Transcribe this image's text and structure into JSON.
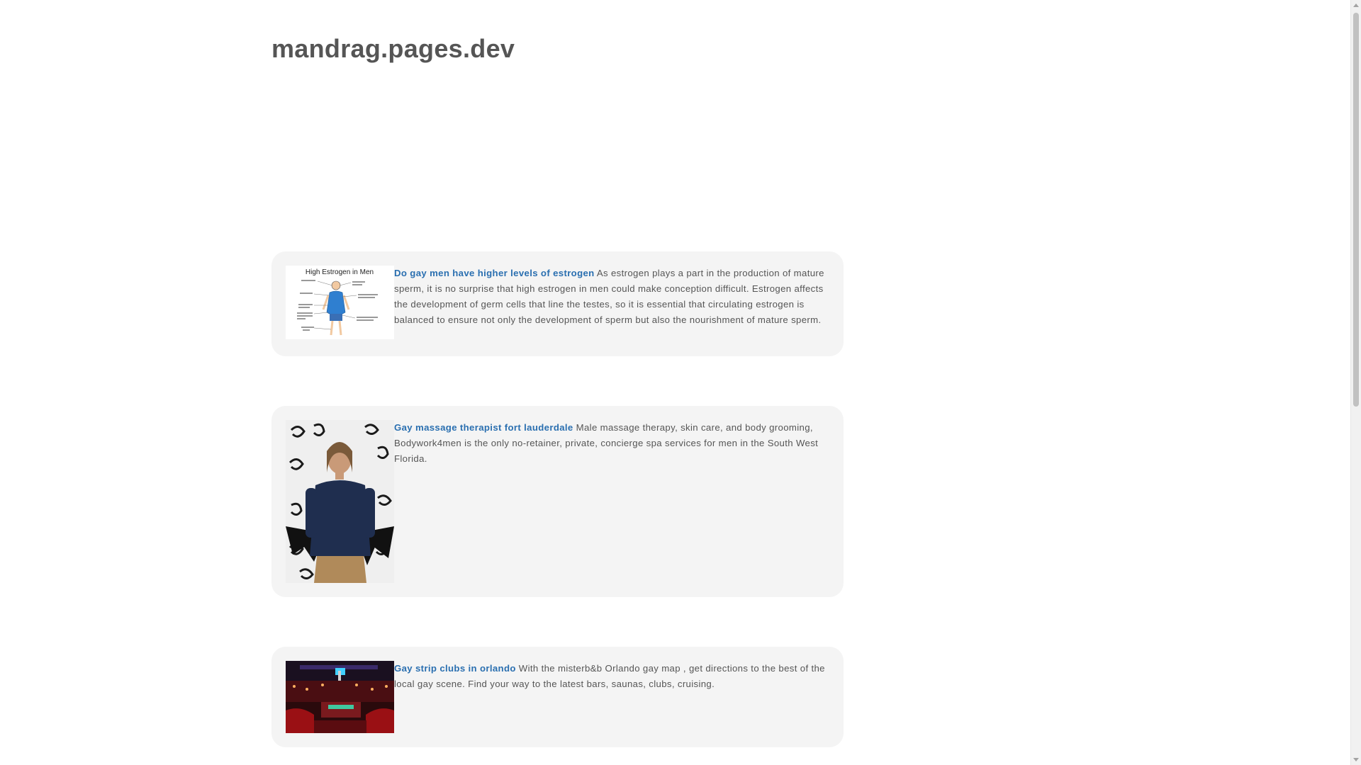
{
  "site": {
    "title": "mandrag.pages.dev"
  },
  "posts": [
    {
      "link": "Do gay men have higher levels of estrogen",
      "body": "As estrogen plays a part in the production of mature sperm, it is no surprise that high estrogen in men could make conception difficult. Estrogen affects the development of germ cells that line the testes, so it is essential that circulating estrogen is balanced to ensure not only the development of sperm but also the nourishment of mature sperm.",
      "image_caption": "High Estrogen in Men"
    },
    {
      "link": "Gay massage therapist fort lauderdale",
      "body": "Male massage therapy, skin care, and body grooming, Bodywork4men is the only no-retainer, private, concierge spa services for men in the South West Florida."
    },
    {
      "link": "Gay strip clubs in orlando",
      "body": "With the misterb&b Orlando gay map , get directions to the best of the local gay scene. Find your way to the latest bars, saunas, clubs, cruising."
    }
  ]
}
